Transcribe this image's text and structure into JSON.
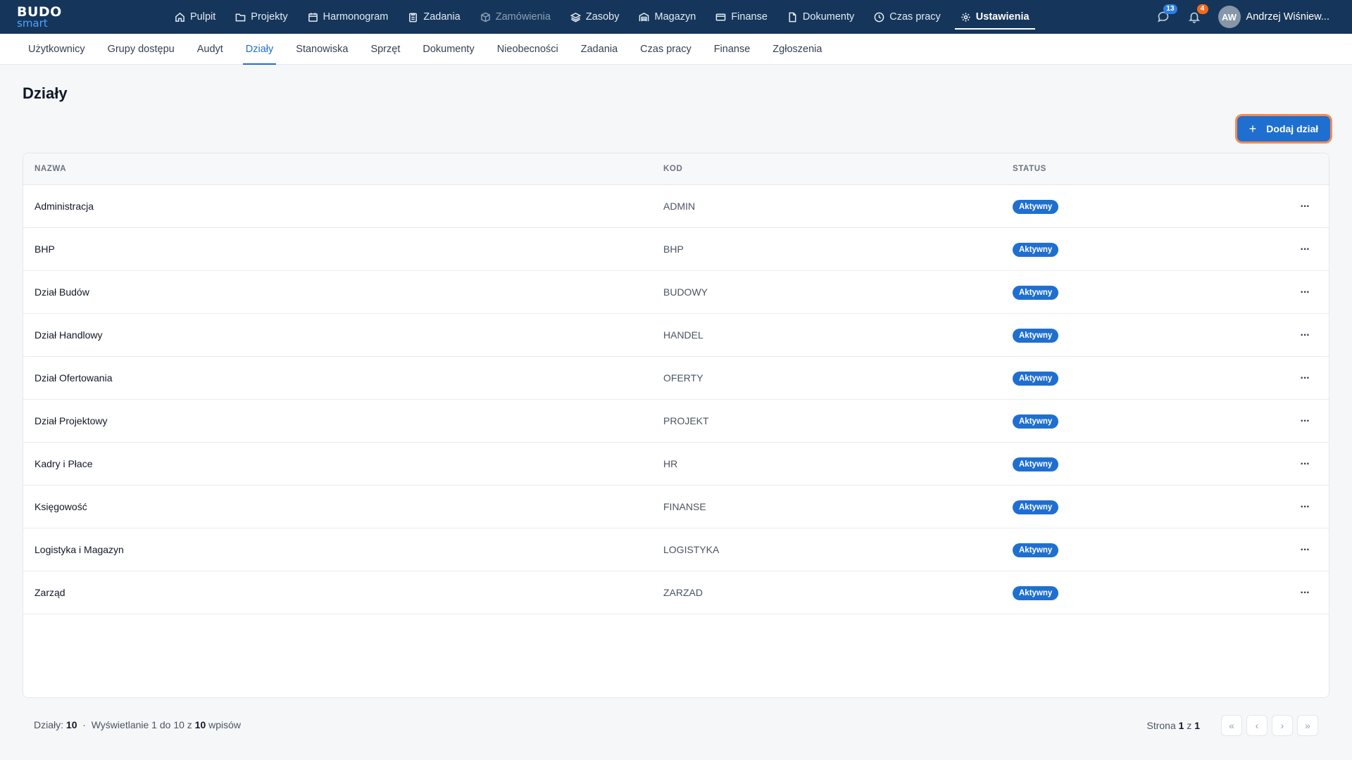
{
  "brand": {
    "line1": "BUDO",
    "line2": "smart"
  },
  "topnav": {
    "items": [
      {
        "label": "Pulpit",
        "icon": "home-icon"
      },
      {
        "label": "Projekty",
        "icon": "folder-icon"
      },
      {
        "label": "Harmonogram",
        "icon": "calendar-icon"
      },
      {
        "label": "Zadania",
        "icon": "clipboard-icon"
      },
      {
        "label": "Zamówienia",
        "icon": "box-icon"
      },
      {
        "label": "Zasoby",
        "icon": "layers-icon"
      },
      {
        "label": "Magazyn",
        "icon": "warehouse-icon"
      },
      {
        "label": "Finanse",
        "icon": "card-icon"
      },
      {
        "label": "Dokumenty",
        "icon": "document-icon"
      },
      {
        "label": "Czas pracy",
        "icon": "clock-icon"
      },
      {
        "label": "Ustawienia",
        "icon": "gear-icon"
      }
    ],
    "active": "Ustawienia",
    "disabled": "Zamówienia",
    "messages_count": "13",
    "notifications_count": "4",
    "user_initials": "AW",
    "user_name": "Andrzej Wiśniew..."
  },
  "subnav": {
    "tabs": [
      "Użytkownicy",
      "Grupy dostępu",
      "Audyt",
      "Działy",
      "Stanowiska",
      "Sprzęt",
      "Dokumenty",
      "Nieobecności",
      "Zadania",
      "Czas pracy",
      "Finanse",
      "Zgłoszenia"
    ],
    "active": "Działy"
  },
  "page": {
    "title": "Działy",
    "add_button_label": "Dodaj dział",
    "add_button_icon": "plus-icon"
  },
  "table": {
    "headers": {
      "name": "NAZWA",
      "code": "KOD",
      "status": "STATUS"
    },
    "rows": [
      {
        "name": "Administracja",
        "code": "ADMIN",
        "status": "Aktywny"
      },
      {
        "name": "BHP",
        "code": "BHP",
        "status": "Aktywny"
      },
      {
        "name": "Dział Budów",
        "code": "BUDOWY",
        "status": "Aktywny"
      },
      {
        "name": "Dział Handlowy",
        "code": "HANDEL",
        "status": "Aktywny"
      },
      {
        "name": "Dział Ofertowania",
        "code": "OFERTY",
        "status": "Aktywny"
      },
      {
        "name": "Dział Projektowy",
        "code": "PROJEKT",
        "status": "Aktywny"
      },
      {
        "name": "Kadry i Płace",
        "code": "HR",
        "status": "Aktywny"
      },
      {
        "name": "Księgowość",
        "code": "FINANSE",
        "status": "Aktywny"
      },
      {
        "name": "Logistyka i Magazyn",
        "code": "LOGISTYKA",
        "status": "Aktywny"
      },
      {
        "name": "Zarząd",
        "code": "ZARZAD",
        "status": "Aktywny"
      }
    ],
    "row_menu_label": "···"
  },
  "footer": {
    "count_label": "Działy:",
    "count": "10",
    "separator": "·",
    "showing_prefix": "Wyświetlanie 1 do 10 z",
    "showing_total": "10",
    "showing_suffix": "wpisów",
    "page_label": "Strona",
    "page_current": "1",
    "page_of": "z",
    "page_total": "1",
    "first_icon": "«",
    "prev_icon": "‹",
    "next_icon": "›",
    "last_icon": "»"
  },
  "colors": {
    "navbar": "#15365a",
    "accent": "#1f6fd1",
    "focus_ring": "#f58b50",
    "badge_orange": "#f06a20"
  }
}
